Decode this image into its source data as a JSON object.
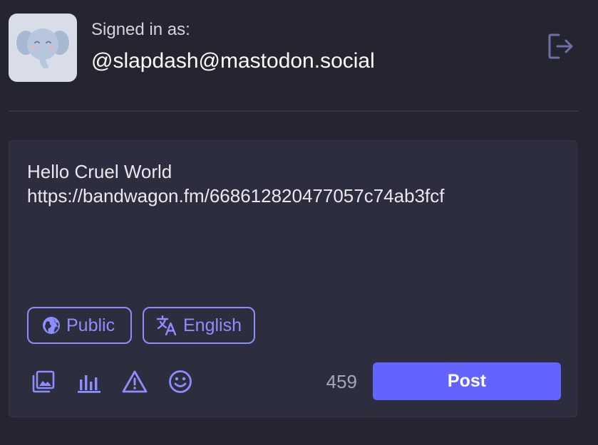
{
  "account": {
    "signed_in_label": "Signed in as:",
    "handle": "@slapdash@mastodon.social",
    "avatar_icon": "mastodon-elephant-icon"
  },
  "header": {
    "logout_icon": "logout-icon"
  },
  "composer": {
    "text": "Hello Cruel World\nhttps://bandwagon.fm/668612820477057c74ab3fcf",
    "visibility": {
      "icon": "globe-icon",
      "label": "Public"
    },
    "language": {
      "icon": "translate-icon",
      "label": "English"
    },
    "toolbar": [
      {
        "name": "media-icon"
      },
      {
        "name": "poll-icon"
      },
      {
        "name": "content-warning-icon"
      },
      {
        "name": "emoji-icon"
      }
    ],
    "char_counter": "459",
    "post_label": "Post"
  },
  "colors": {
    "background": "#242530",
    "composer_bg": "#2d2e3d",
    "accent": "#8c8dff",
    "button": "#6364ff"
  }
}
